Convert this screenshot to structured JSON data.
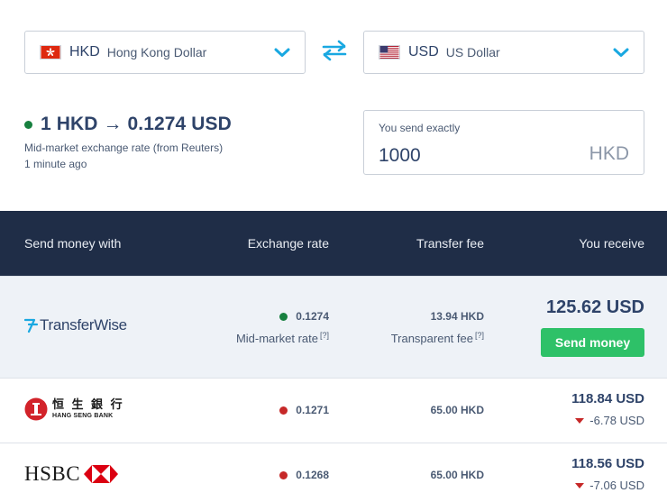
{
  "from_currency": {
    "code": "HKD",
    "name": "Hong Kong Dollar",
    "flag": "hk-flag-icon"
  },
  "to_currency": {
    "code": "USD",
    "name": "US Dollar",
    "flag": "us-flag-icon"
  },
  "rate": {
    "headline": "1 HKD → 0.1274 USD",
    "source": "Mid-market exchange rate (from Reuters)",
    "updated": "1 minute ago"
  },
  "amount": {
    "label": "You send exactly",
    "value": "1000",
    "currency": "HKD"
  },
  "table": {
    "headers": [
      "Send money with",
      "Exchange rate",
      "Transfer fee",
      "You receive"
    ],
    "rows": [
      {
        "provider": "TransferWise",
        "rate": "0.1274",
        "rate_status": "green",
        "rate_note": "Mid-market rate",
        "fee": "13.94 HKD",
        "fee_note": "Transparent fee",
        "help_marker": "[?]",
        "receive": "125.62 USD",
        "cta": "Send money"
      },
      {
        "provider": "HANG SENG BANK",
        "provider_logo_text": "恒 生 銀 行",
        "rate": "0.1271",
        "rate_status": "red",
        "fee": "65.00 HKD",
        "receive": "118.84 USD",
        "diff": "-6.78 USD"
      },
      {
        "provider": "HSBC",
        "rate": "0.1268",
        "rate_status": "red",
        "fee": "65.00 HKD",
        "receive": "118.56 USD",
        "diff": "-7.06 USD"
      }
    ]
  },
  "colors": {
    "header_bg": "#1f2d47",
    "accent_blue": "#19a8e1",
    "cta_green": "#2ec168",
    "status_green": "#17803f",
    "status_red": "#c62828",
    "text_navy": "#2e4369"
  }
}
